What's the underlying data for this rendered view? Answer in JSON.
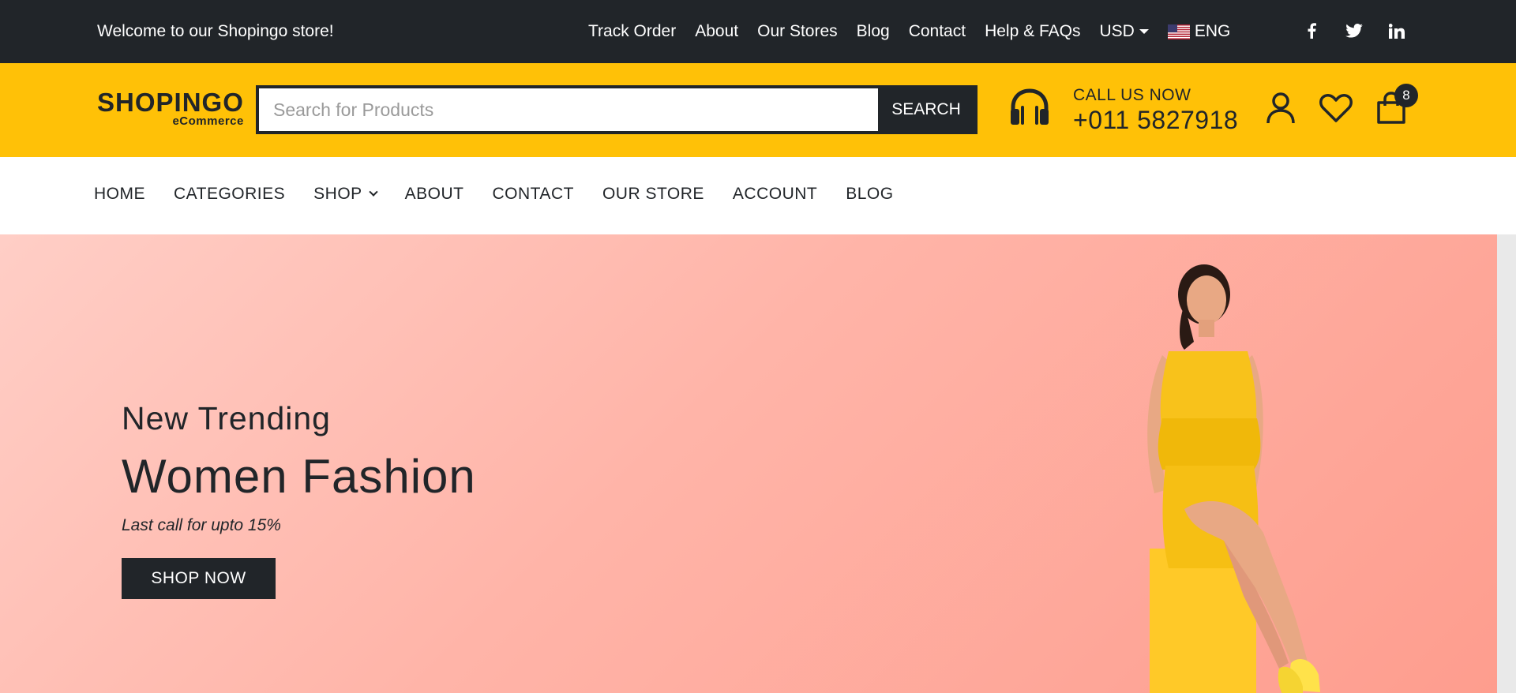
{
  "topbar": {
    "welcome": "Welcome to our Shopingo store!",
    "links": [
      "Track Order",
      "About",
      "Our Stores",
      "Blog",
      "Contact",
      "Help & FAQs"
    ],
    "currency": "USD",
    "language": "ENG",
    "social": [
      "facebook-icon",
      "twitter-icon",
      "linkedin-icon"
    ]
  },
  "header": {
    "logo_main": "SHOPINGO",
    "logo_sub": "eCommerce",
    "search_placeholder": "Search for Products",
    "search_button": "SEARCH",
    "call_label": "CALL US NOW",
    "call_number": "+011 5827918",
    "cart_count": "8"
  },
  "nav": {
    "items": [
      "HOME",
      "CATEGORIES",
      "SHOP",
      "ABOUT",
      "CONTACT",
      "OUR STORE",
      "ACCOUNT",
      "BLOG"
    ]
  },
  "hero": {
    "subtitle": "New Trending",
    "title": "Women Fashion",
    "tagline": "Last call for upto 15%",
    "button": "SHOP NOW"
  },
  "colors": {
    "dark": "#212529",
    "accent": "#ffc107",
    "hero_gradient": [
      "#ffcec6",
      "#fe9d8e"
    ]
  }
}
